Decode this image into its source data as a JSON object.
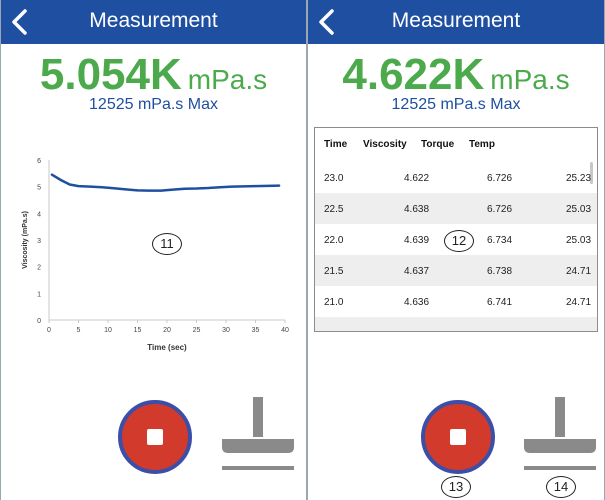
{
  "left": {
    "header": {
      "title": "Measurement"
    },
    "reading": {
      "value": "5.054K",
      "unit": "mPa.s",
      "max": "12525 mPa.s Max"
    },
    "chart_data": {
      "type": "line",
      "title": "",
      "xlabel": "Time (sec)",
      "ylabel": "Viscosity (mPa.s)",
      "xlim": [
        0,
        40
      ],
      "ylim": [
        0,
        6
      ],
      "xticks": [
        0,
        5,
        10,
        15,
        20,
        25,
        30,
        35,
        40
      ],
      "yticks": [
        0,
        1,
        2,
        3,
        4,
        5,
        6
      ],
      "grid": false,
      "series": [
        {
          "color": "#1f4fa0",
          "x": [
            0.5,
            2,
            3.5,
            5,
            7,
            9,
            11,
            13,
            15,
            17,
            19,
            21,
            23,
            25,
            27,
            29,
            31,
            33,
            35,
            37,
            39
          ],
          "y": [
            5.45,
            5.25,
            5.08,
            5.02,
            5.0,
            4.98,
            4.94,
            4.9,
            4.86,
            4.85,
            4.85,
            4.89,
            4.92,
            4.93,
            4.95,
            4.98,
            5.0,
            5.01,
            5.02,
            5.03,
            5.04
          ]
        }
      ]
    },
    "marker": "11"
  },
  "right": {
    "header": {
      "title": "Measurement"
    },
    "reading": {
      "value": "4.622K",
      "unit": "mPa.s",
      "max": "12525 mPa.s Max"
    },
    "table": {
      "headers": [
        "Time",
        "Viscosity",
        "Torque",
        "Temp"
      ],
      "rows": [
        [
          "23.0",
          "4.622",
          "6.726",
          "25.23"
        ],
        [
          "22.5",
          "4.638",
          "6.726",
          "25.03"
        ],
        [
          "22.0",
          "4.639",
          "6.734",
          "25.03"
        ],
        [
          "21.5",
          "4.637",
          "6.738",
          "24.71"
        ],
        [
          "21.0",
          "4.636",
          "6.741",
          "24.71"
        ]
      ]
    },
    "markers": {
      "table": "12",
      "stop": "13",
      "probe": "14"
    }
  },
  "colors": {
    "header": "#1f4fa0",
    "value_green": "#4caa4c",
    "stop_red": "#d23a2c",
    "stop_ring": "#3b4fa8",
    "probe_gray": "#8a8a8a"
  },
  "icons": {
    "back": "chevron-left-icon",
    "stop": "stop-square-icon",
    "probe": "spindle-probe-icon"
  }
}
